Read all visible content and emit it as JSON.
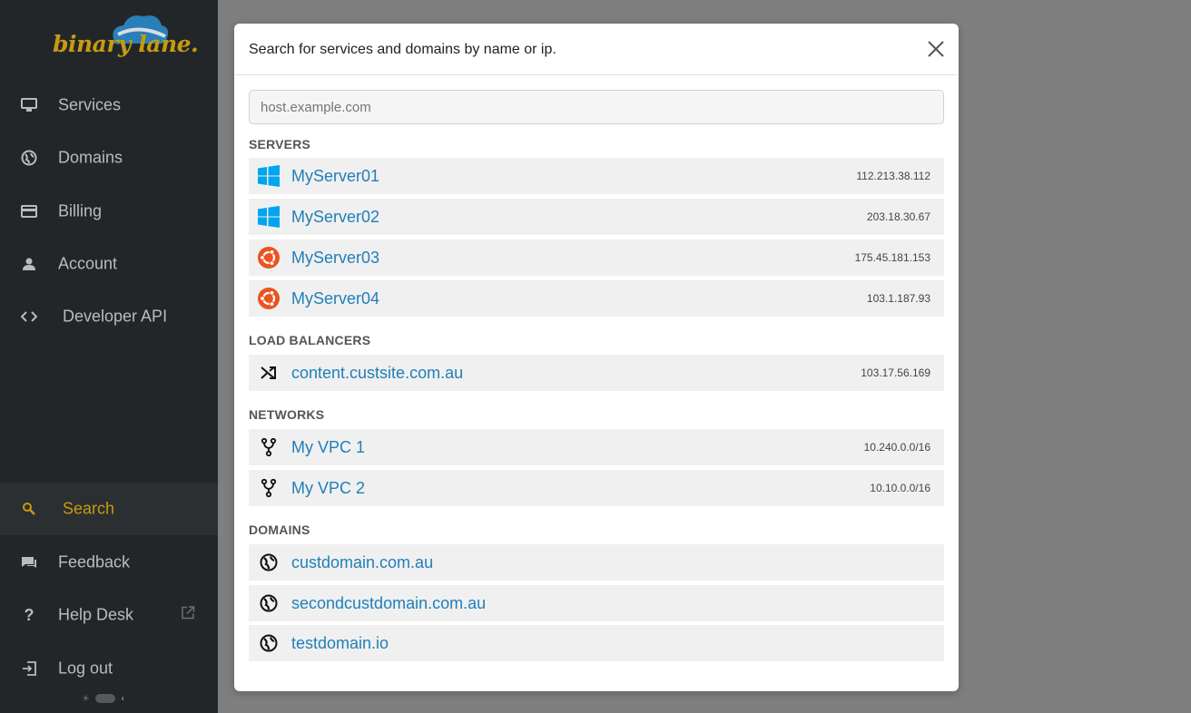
{
  "brand": {
    "logo_text": "binary lane."
  },
  "sidebar": {
    "items": [
      {
        "label": "Services",
        "icon": "monitor-icon"
      },
      {
        "label": "Domains",
        "icon": "globe-icon"
      },
      {
        "label": "Billing",
        "icon": "credit-card-icon"
      },
      {
        "label": "Account",
        "icon": "user-icon"
      },
      {
        "label": "Developer API",
        "icon": "code-icon"
      }
    ],
    "bottom_items": [
      {
        "label": "Search",
        "icon": "search-icon",
        "active": true
      },
      {
        "label": "Feedback",
        "icon": "chat-icon"
      },
      {
        "label": "Help Desk",
        "icon": "question-icon"
      },
      {
        "label": "Log out",
        "icon": "logout-icon"
      }
    ]
  },
  "modal": {
    "title": "Search for services and domains by name or ip.",
    "search_placeholder": "host.example.com",
    "search_value": "",
    "sections": {
      "servers": {
        "title": "SERVERS",
        "items": [
          {
            "name": "MyServer01",
            "ip": "112.213.38.112",
            "icon": "windows-icon"
          },
          {
            "name": "MyServer02",
            "ip": "203.18.30.67",
            "icon": "windows-icon"
          },
          {
            "name": "MyServer03",
            "ip": "175.45.181.153",
            "icon": "ubuntu-icon"
          },
          {
            "name": "MyServer04",
            "ip": "103.1.187.93",
            "icon": "ubuntu-icon"
          }
        ]
      },
      "load_balancers": {
        "title": "LOAD BALANCERS",
        "items": [
          {
            "name": "content.custsite.com.au",
            "ip": "103.17.56.169",
            "icon": "shuffle-icon"
          }
        ]
      },
      "networks": {
        "title": "NETWORKS",
        "items": [
          {
            "name": "My VPC 1",
            "ip": "10.240.0.0/16",
            "icon": "network-icon"
          },
          {
            "name": "My VPC 2",
            "ip": "10.10.0.0/16",
            "icon": "network-icon"
          }
        ]
      },
      "domains": {
        "title": "DOMAINS",
        "items": [
          {
            "name": "custdomain.com.au",
            "icon": "globe-icon"
          },
          {
            "name": "secondcustdomain.com.au",
            "icon": "globe-icon"
          },
          {
            "name": "testdomain.io",
            "icon": "globe-icon"
          }
        ]
      }
    }
  },
  "colors": {
    "sidebar_bg": "#232628",
    "accent": "#c79a12",
    "link": "#1f7fb9",
    "windows": "#00a4ef",
    "ubuntu": "#e95420",
    "overlay": "#7f7f7f"
  }
}
